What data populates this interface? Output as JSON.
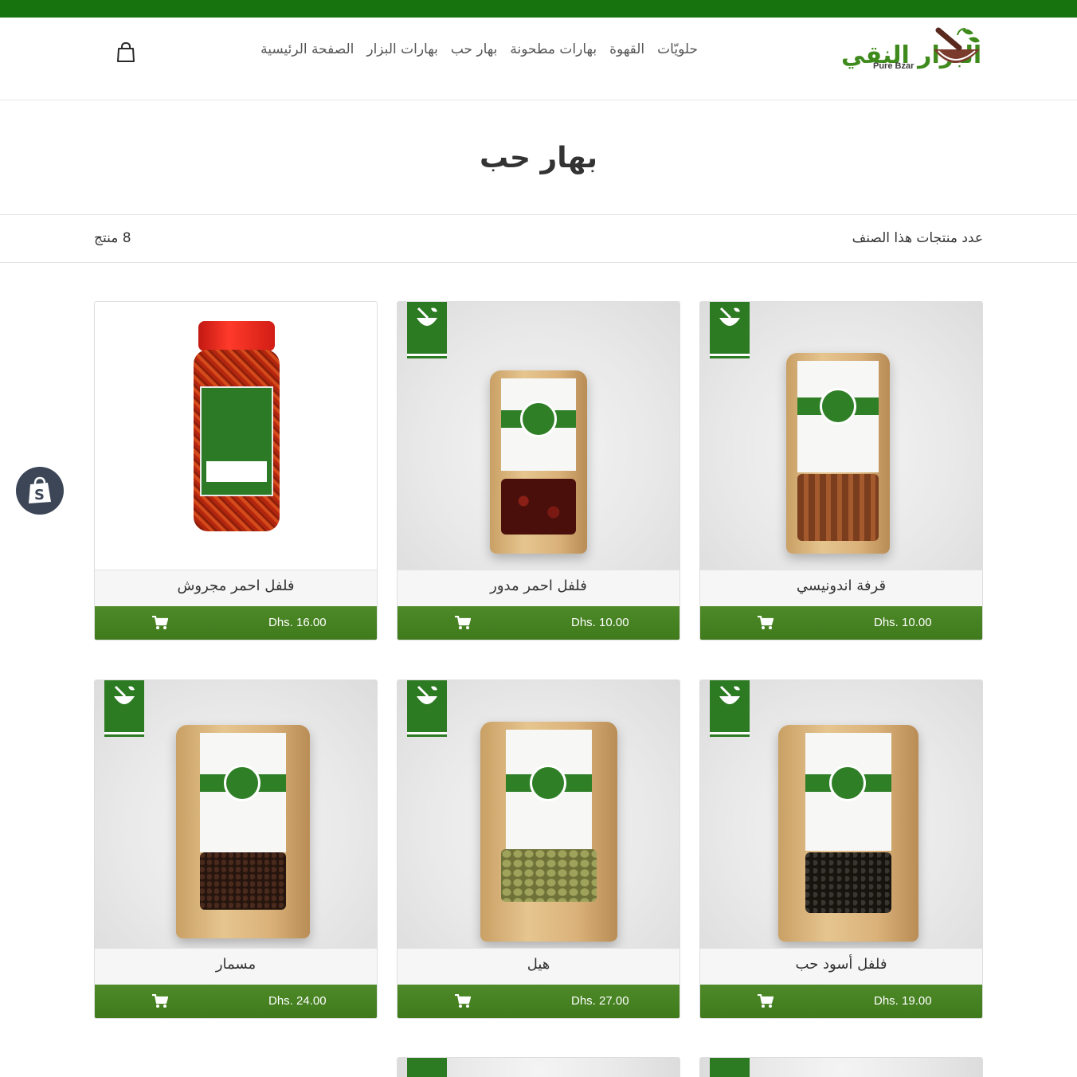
{
  "brand": {
    "name_ar": "البزار النقي",
    "name_en": "Pure Bzar",
    "top_bar_color": "#17730e",
    "accent_color": "#3f7a1c"
  },
  "nav": {
    "items": [
      {
        "label": "الصفحة الرئيسية"
      },
      {
        "label": "بهارات البزار"
      },
      {
        "label": "بهار حب"
      },
      {
        "label": "بهارات مطحونة"
      },
      {
        "label": "القهوة"
      },
      {
        "label": "حلويّات"
      }
    ],
    "cart_icon": "shopping-bag-icon"
  },
  "collection": {
    "title": "بهار حب",
    "count_label": "عدد منتجات هذا الصنف",
    "count_value": "8 منتج"
  },
  "products": [
    {
      "title": "قرفة اندونيسي",
      "price": "Dhs. 10.00",
      "image": "cinnamon-pouch",
      "window_color": "#8b4a22"
    },
    {
      "title": "فلفل احمر مدور",
      "price": "Dhs. 10.00",
      "image": "red-pepper-pouch",
      "window_color": "#5a1410"
    },
    {
      "title": "فلفل احمر مجروش",
      "price": "Dhs. 16.00",
      "image": "crushed-pepper-jar",
      "window_color": "#b5260f"
    },
    {
      "title": "فلفل أسود حب",
      "price": "Dhs. 19.00",
      "image": "black-pepper-pouch",
      "window_color": "#1c1a17"
    },
    {
      "title": "هيل",
      "price": "Dhs. 27.00",
      "image": "cardamom-pouch",
      "window_color": "#8a8a4a"
    },
    {
      "title": "مسمار",
      "price": "Dhs. 24.00",
      "image": "cloves-pouch",
      "window_color": "#2e1a12"
    }
  ],
  "icons": {
    "add_to_cart": "cart-icon",
    "shopify": "shopify-icon"
  }
}
